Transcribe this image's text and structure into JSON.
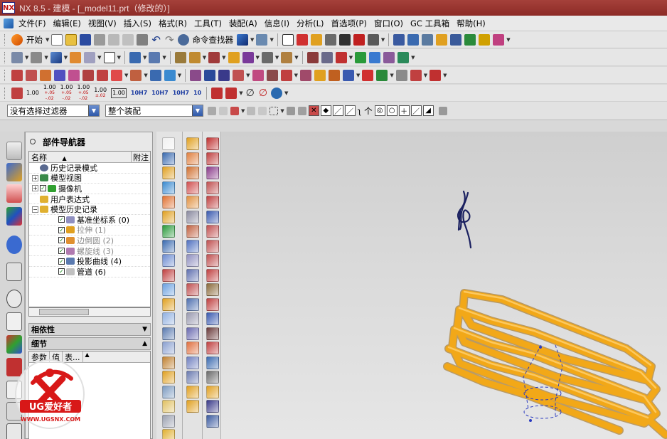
{
  "window": {
    "title": "NX 8.5 - 建模 - [_model11.prt（修改的）]"
  },
  "menubar": {
    "items": [
      "文件(F)",
      "编辑(E)",
      "视图(V)",
      "插入(S)",
      "格式(R)",
      "工具(T)",
      "装配(A)",
      "信息(I)",
      "分析(L)",
      "首选项(P)",
      "窗口(O)",
      "GC 工具箱",
      "帮助(H)"
    ]
  },
  "toolbar1": {
    "start_label": "开始",
    "command_finder_label": "命令查找器"
  },
  "toolbar4": {
    "tolerances": [
      "1.00",
      "1.00",
      "1.00",
      "1.00",
      "1.00",
      "1.00",
      "10H7",
      "10H7",
      "10H7",
      "10"
    ]
  },
  "selection_bar": {
    "filter_value": "没有选择过滤器",
    "scope_value": "整个装配"
  },
  "navigator": {
    "title": "部件导航器",
    "col_name": "名称",
    "col_note": "附注",
    "rows": [
      {
        "label": "历史记录模式",
        "indent": 0,
        "state": "clock",
        "dim": false
      },
      {
        "label": "模型视图",
        "indent": 0,
        "state": "plus",
        "dim": false
      },
      {
        "label": "摄像机",
        "indent": 0,
        "state": "plus-check",
        "dim": false
      },
      {
        "label": "用户表达式",
        "indent": 0,
        "state": "none",
        "dim": false
      },
      {
        "label": "模型历史记录",
        "indent": 0,
        "state": "minus",
        "dim": false
      },
      {
        "label": "基准坐标系 (0)",
        "indent": 1,
        "state": "check",
        "dim": false
      },
      {
        "label": "拉伸 (1)",
        "indent": 1,
        "state": "check",
        "dim": true
      },
      {
        "label": "边倒圆 (2)",
        "indent": 1,
        "state": "check",
        "dim": true
      },
      {
        "label": "螺旋线 (3)",
        "indent": 1,
        "state": "check",
        "dim": true
      },
      {
        "label": "投影曲线 (4)",
        "indent": 1,
        "state": "check",
        "dim": false
      },
      {
        "label": "管道 (6)",
        "indent": 1,
        "state": "check",
        "dim": false
      }
    ],
    "dependency_label": "相依性",
    "details_label": "细节",
    "detail_cols": [
      "参数",
      "值",
      "表..."
    ]
  },
  "watermark": {
    "brand": "UG爱好者",
    "url": "WWW.UGSNX.COM"
  },
  "colors": {
    "titlebar": "#a5413a",
    "pipe": "#f2a818",
    "curve": "#1a2060"
  }
}
